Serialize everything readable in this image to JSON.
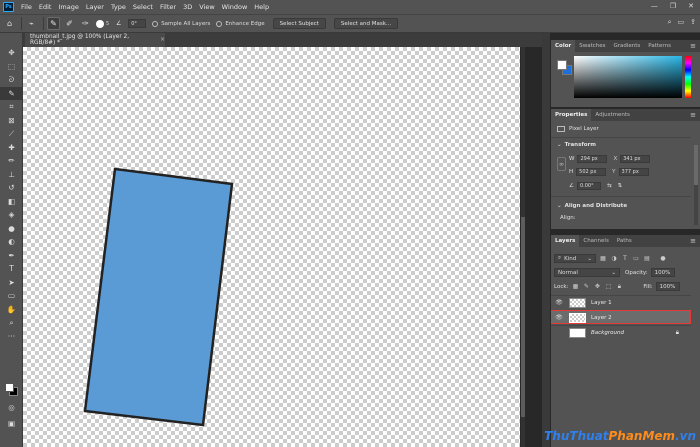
{
  "app": {
    "logo": "Ps"
  },
  "menu": [
    "File",
    "Edit",
    "Image",
    "Layer",
    "Type",
    "Select",
    "Filter",
    "3D",
    "View",
    "Window",
    "Help"
  ],
  "window_controls": {
    "minimize": "—",
    "restore": "❐",
    "close": "✕"
  },
  "options_bar": {
    "brush_size": "5",
    "angle": "0°",
    "sample_all_layers": "Sample All Layers",
    "enhance_edge": "Enhance Edge",
    "select_subject": "Select Subject",
    "select_and_mask": "Select and Mask..."
  },
  "document": {
    "tab_title": "thumbnail_t.jpg @ 100% (Layer 2, RGB/8#) *",
    "close": "×"
  },
  "shape": {
    "fill": "#5b9bd5",
    "stroke": "#222222"
  },
  "color_panel": {
    "tabs": [
      "Color",
      "Swatches",
      "Gradients",
      "Patterns"
    ],
    "foreground": "#ffffff",
    "background": "#1f6fdb"
  },
  "properties_panel": {
    "tabs": [
      "Properties",
      "Adjustments"
    ],
    "layer_type": "Pixel Layer",
    "transform_heading": "Transform",
    "w_label": "W",
    "w_value": "294 px",
    "h_label": "H",
    "h_value": "502 px",
    "x_label": "X",
    "x_value": "341 px",
    "y_label": "Y",
    "y_value": "377 px",
    "angle_value": "0.00°",
    "align_heading": "Align and Distribute",
    "align_label": "Align:"
  },
  "layers_panel": {
    "tabs": [
      "Layers",
      "Channels",
      "Paths"
    ],
    "filter_kind": "Kind",
    "blend_mode": "Normal",
    "opacity_label": "Opacity:",
    "opacity_value": "100%",
    "lock_label": "Lock:",
    "fill_label": "Fill:",
    "fill_value": "100%",
    "layers": [
      {
        "name": "Layer 1",
        "visible": true,
        "selected": false
      },
      {
        "name": "Layer 2",
        "visible": true,
        "selected": true
      },
      {
        "name": "Background",
        "visible": false,
        "selected": false
      }
    ]
  },
  "watermark": {
    "part1": "ThuThuat",
    "part2": "PhanMem",
    "part3": ".vn"
  }
}
